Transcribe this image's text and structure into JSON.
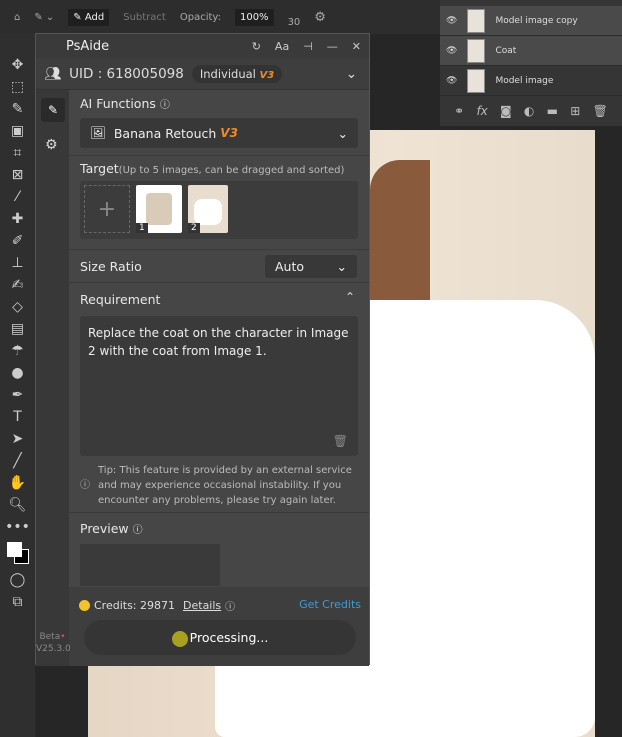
{
  "toolbar": {
    "add": "Add",
    "subtract": "Subtract",
    "opacity_label": "Opacity:",
    "opacity_value": "100%",
    "brush_size": "30"
  },
  "layers": [
    {
      "name": "Model image copy"
    },
    {
      "name": "Coat"
    },
    {
      "name": "Model image"
    }
  ],
  "panel": {
    "title": "PsAide",
    "font_btn": "Aa",
    "uid": "UID : 618005098",
    "plan": "Individual",
    "plan_version": "V3",
    "ai_functions_label": "AI Functions",
    "function": "Banana Retouch",
    "function_version": "V3",
    "target_label": "Target",
    "target_hint": "(Up to 5 images, can be dragged and sorted)",
    "target_images": [
      "1",
      "2"
    ],
    "size_ratio_label": "Size Ratio",
    "size_ratio_value": "Auto",
    "requirement_label": "Requirement",
    "requirement_text": "Replace the coat on the character in Image 2 with the coat from Image 1.",
    "tip": "Tip: This feature is provided by an external service and may experience occasional instability. If you encounter any problems, please try again later.",
    "preview_label": "Preview",
    "credits": "Credits: 29871",
    "details": "Details",
    "get_credits": "Get Credits",
    "processing": "Processing...",
    "beta": "Beta",
    "version": "V25.3.0"
  },
  "colors": {
    "accent_link": "#3d9bd6",
    "version_orange": "#f08a2a",
    "coin": "#f2c230"
  }
}
